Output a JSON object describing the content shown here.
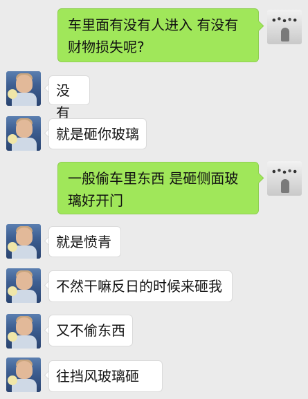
{
  "messages": [
    {
      "sender": "self",
      "text": "车里面有没有人进入 有没有财物损失呢?"
    },
    {
      "sender": "other",
      "text": "没有"
    },
    {
      "sender": "other",
      "text": "就是砸你玻璃"
    },
    {
      "sender": "self",
      "text": "一般偷车里东西 是砸侧面玻璃好开门"
    },
    {
      "sender": "other",
      "text": "就是愤青"
    },
    {
      "sender": "other",
      "text": "不然干嘛反日的时候来砸我"
    },
    {
      "sender": "other",
      "text": "又不偷东西"
    },
    {
      "sender": "other",
      "text": "往挡风玻璃砸"
    }
  ],
  "colors": {
    "background": "#ebebeb",
    "sent_bubble": "#a0e75a",
    "received_bubble": "#ffffff"
  }
}
